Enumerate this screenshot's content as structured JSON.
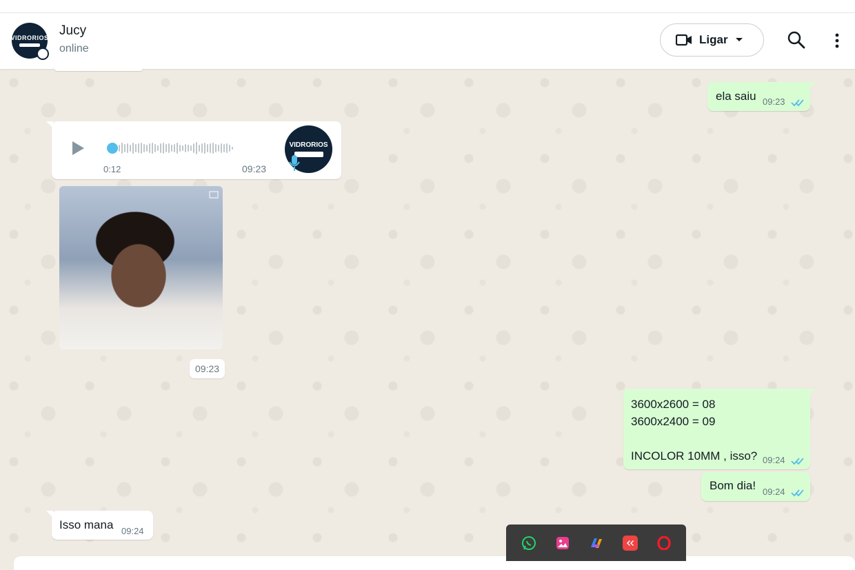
{
  "header": {
    "contact_name": "Jucy",
    "contact_status": "online",
    "avatar_brand": "VIDRORIOS",
    "call_label": "Ligar"
  },
  "messages": {
    "m1": {
      "text": "ela saiu",
      "time": "09:23",
      "direction": "out",
      "status": "read"
    },
    "audio": {
      "duration": "0:12",
      "time": "09:23",
      "direction": "in",
      "avatar_brand": "VIDRORIOS"
    },
    "photo": {
      "time": "09:23",
      "direction": "in"
    },
    "m2": {
      "line1": "3600x2600 = 08",
      "line2": "3600x2400 = 09",
      "line3": "INCOLOR 10MM , isso?",
      "time": "09:24",
      "direction": "out",
      "status": "read"
    },
    "m3": {
      "text": "Bom dia!",
      "time": "09:24",
      "direction": "out",
      "status": "read"
    },
    "m4": {
      "text": "Isso mana",
      "time": "09:24",
      "direction": "in"
    }
  },
  "dock": {
    "apps": [
      "whatsapp-icon",
      "gallery-icon",
      "copilot-icon",
      "anydesk-icon",
      "opera-icon"
    ]
  },
  "colors": {
    "outgoing_bubble": "#d9fdd3",
    "incoming_bubble": "#ffffff",
    "read_ticks": "#53bdeb",
    "wallpaper": "#efeae2"
  }
}
